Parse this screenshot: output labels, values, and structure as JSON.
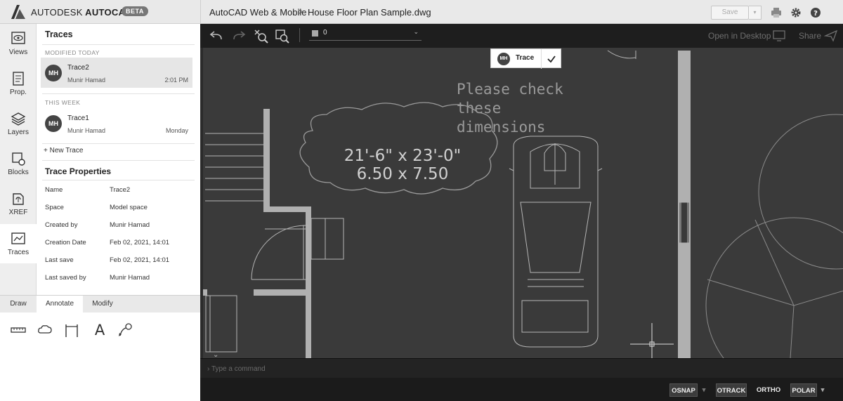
{
  "app": {
    "brand_bold": "AUTODESK",
    "brand_name": "AUTOCAD",
    "badge": "BETA",
    "breadcrumb_app": "AutoCAD Web & Mobile",
    "breadcrumb_separator": ">",
    "breadcrumb_file": "House Floor Plan Sample.dwg",
    "save_label": "Save"
  },
  "rail": [
    {
      "label": "Views",
      "icon": "eye-icon"
    },
    {
      "label": "Prop.",
      "icon": "properties-icon"
    },
    {
      "label": "Layers",
      "icon": "layers-icon"
    },
    {
      "label": "Blocks",
      "icon": "blocks-icon"
    },
    {
      "label": "XREF",
      "icon": "xref-icon"
    },
    {
      "label": "Traces",
      "icon": "traces-icon",
      "active": true
    }
  ],
  "traces_panel": {
    "title": "Traces",
    "sections": [
      {
        "label": "MODIFIED TODAY",
        "items": [
          {
            "initials": "MH",
            "name": "Trace2",
            "author": "Munir Hamad",
            "date": "2:01 PM",
            "selected": true
          }
        ]
      },
      {
        "label": "THIS WEEK",
        "items": [
          {
            "initials": "MH",
            "name": "Trace1",
            "author": "Munir Hamad",
            "date": "Monday",
            "selected": false
          }
        ]
      }
    ],
    "new_trace_label": "+ New Trace"
  },
  "trace_properties": {
    "title": "Trace Properties",
    "rows": [
      {
        "key": "Name",
        "value": "Trace2"
      },
      {
        "key": "Space",
        "value": "Model space"
      },
      {
        "key": "Created by",
        "value": "Munir Hamad"
      },
      {
        "key": "Creation Date",
        "value": "Feb 02, 2021, 14:01"
      },
      {
        "key": "Last save",
        "value": "Feb 02, 2021, 14:01"
      },
      {
        "key": "Last saved by",
        "value": "Munir Hamad"
      }
    ]
  },
  "tool_tabs": {
    "tabs": [
      "Draw",
      "Annotate",
      "Modify"
    ],
    "active": "Annotate",
    "tools": [
      "ruler-icon",
      "cloud-icon",
      "dimension-icon",
      "text-icon",
      "leader-icon"
    ],
    "text_tool_glyph": "A"
  },
  "canvas_toolbar": {
    "layer_name": "0",
    "open_in_desktop": "Open in Desktop",
    "share": "Share"
  },
  "trace_chip": {
    "initials": "MH",
    "label": "Trace"
  },
  "drawing": {
    "note_line1": "Please check",
    "note_line2": "these",
    "note_line3": "dimensions",
    "cloud_line1": "21'-6\" x 23'-0\"",
    "cloud_line2": "6.50 x 7.50"
  },
  "command": {
    "placeholder": "Type a command"
  },
  "status": {
    "osnap": "OSNAP",
    "otrack": "OTRACK",
    "ortho": "ORTHO",
    "polar": "POLAR"
  },
  "colors": {
    "canvas": "#3a3a3a",
    "trace_markup": "#9a9a9a",
    "wall_fill": "#b0b0b0"
  }
}
